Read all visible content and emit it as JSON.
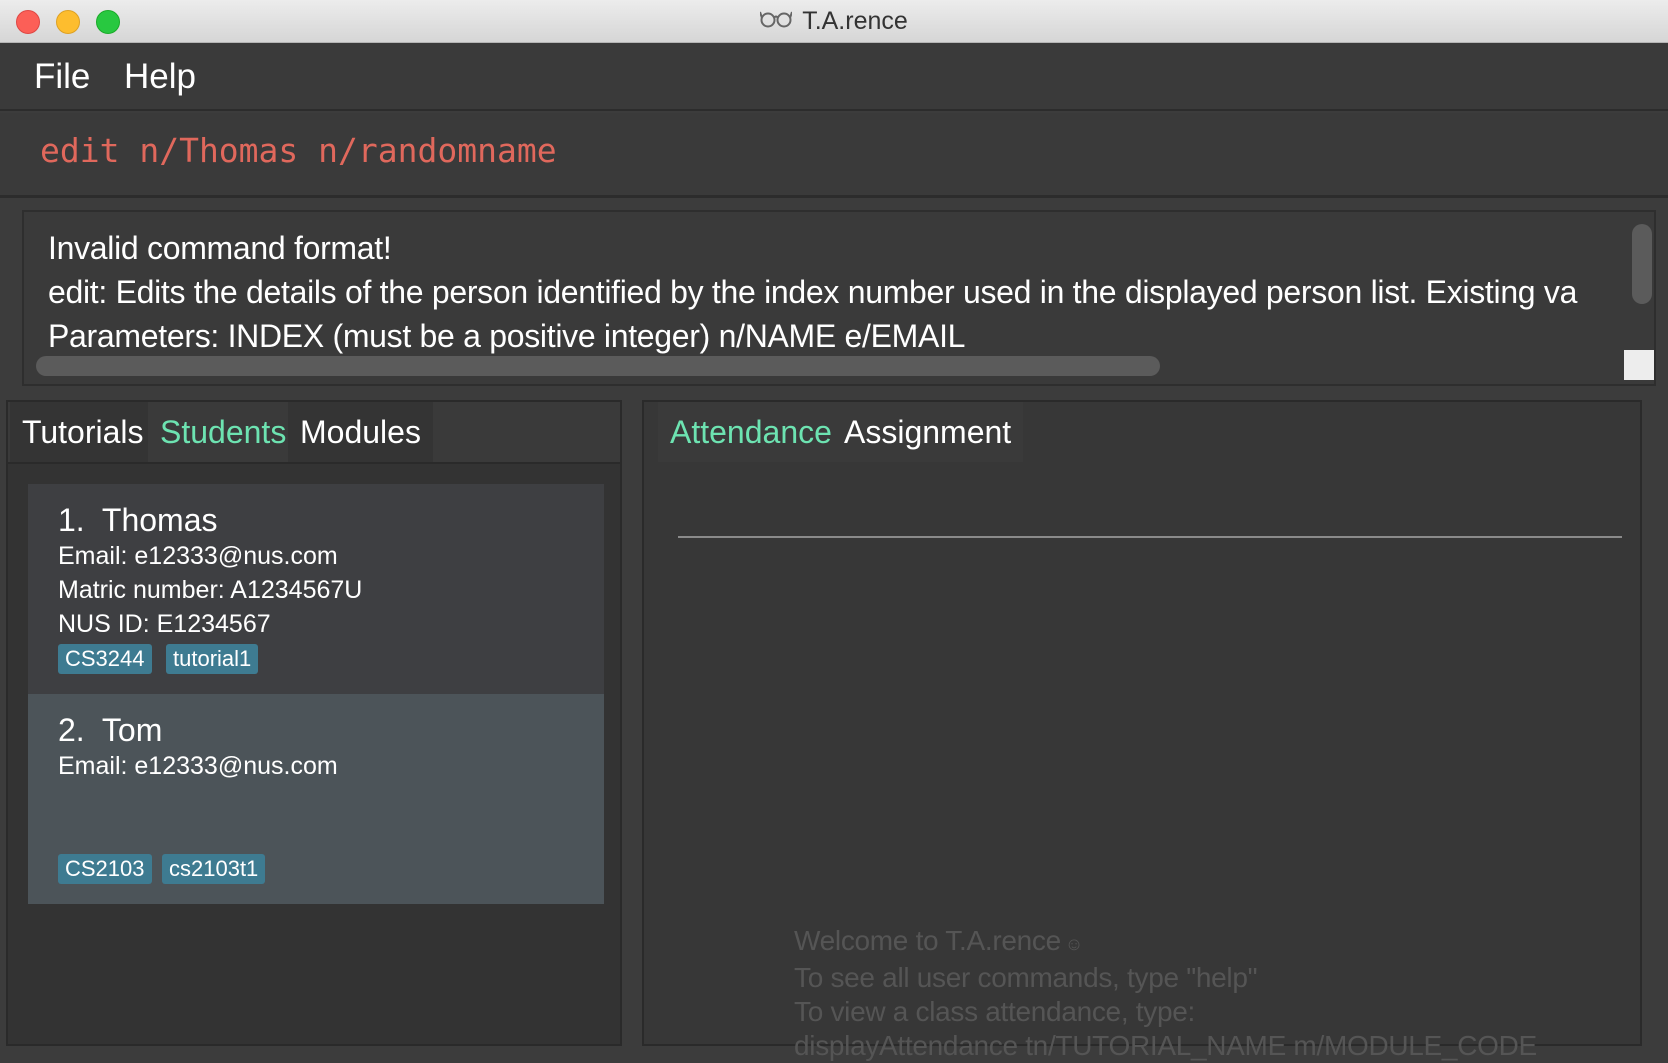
{
  "window": {
    "title": "T.A.rence",
    "title_icon": "glasses-icon"
  },
  "menu": {
    "file_label": "File",
    "help_label": "Help"
  },
  "command_box": {
    "value": "edit n/Thomas n/randomname",
    "text_color": "#e0685c"
  },
  "result_display": {
    "lines": [
      "Invalid command format!",
      "edit: Edits the details of the person identified by the index number used in the displayed person list. Existing va",
      "Parameters: INDEX (must be a positive integer) n/NAME e/EMAIL"
    ]
  },
  "left_tabs": {
    "items": [
      {
        "label": "Tutorials",
        "selected": false
      },
      {
        "label": "Students",
        "selected": true
      },
      {
        "label": "Modules",
        "selected": false
      }
    ]
  },
  "students": [
    {
      "index": "1.",
      "name": "Thomas",
      "email": "Email: e12333@nus.com",
      "matric": "Matric number: A1234567U",
      "nusid": "NUS ID: E1234567",
      "tags": [
        "CS3244",
        "tutorial1"
      ]
    },
    {
      "index": "2.",
      "name": "Tom",
      "email": "Email: e12333@nus.com",
      "tags": [
        "CS2103",
        "cs2103t1"
      ]
    }
  ],
  "right_tabs": {
    "items": [
      {
        "label": "Attendance",
        "selected": true
      },
      {
        "label": "Assignment",
        "selected": false
      }
    ]
  },
  "welcome": {
    "lines": [
      "Welcome to T.A.rence",
      "To see all user commands, type \"help\"",
      "To view a class attendance, type:",
      "displayAttendance tn/TUTORIAL_NAME m/MODULE_CODE"
    ],
    "icon": "smile-icon"
  },
  "colors": {
    "selected_tab": "#6de3b1",
    "tag_bg": "#3e7b91",
    "error_command": "#e0685c"
  }
}
